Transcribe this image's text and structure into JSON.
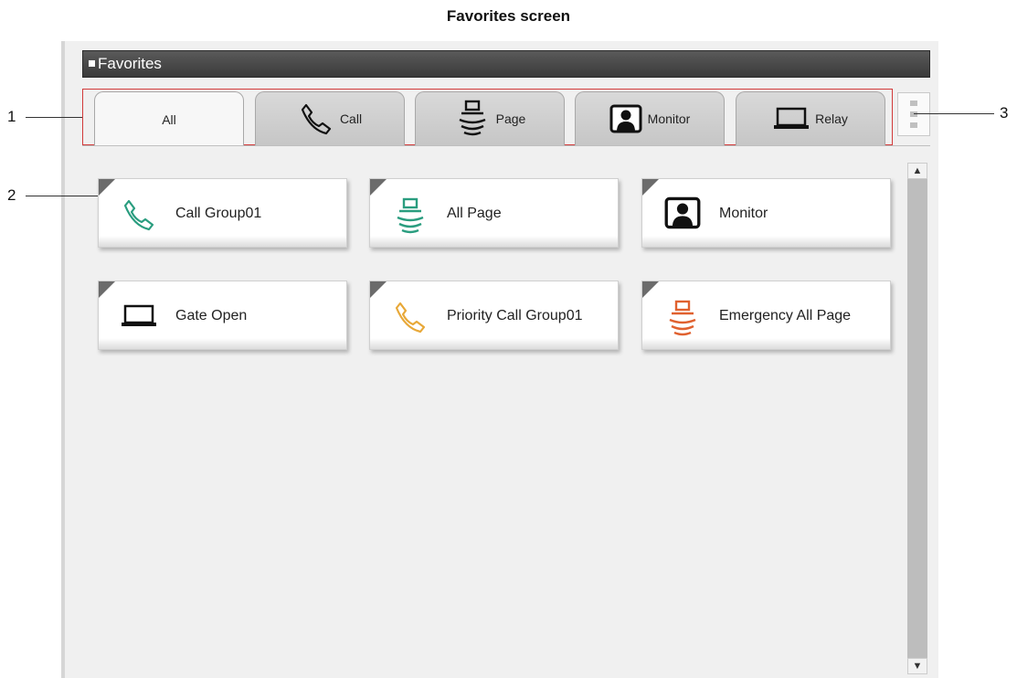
{
  "caption": "Favorites screen",
  "panel_title": "Favorites",
  "tabs": [
    {
      "label": "All",
      "icon": "none",
      "active": true
    },
    {
      "label": "Call",
      "icon": "phone-icon"
    },
    {
      "label": "Page",
      "icon": "speaker-icon"
    },
    {
      "label": "Monitor",
      "icon": "monitor-icon"
    },
    {
      "label": "Relay",
      "icon": "relay-icon"
    }
  ],
  "favorites": [
    {
      "label": "Call Group01",
      "icon": "phone-icon",
      "color": "#2a9d7f"
    },
    {
      "label": "All Page",
      "icon": "speaker-icon",
      "color": "#2a9d7f"
    },
    {
      "label": "Monitor",
      "icon": "monitor-icon",
      "color": "#111111"
    },
    {
      "label": "Gate Open",
      "icon": "relay-icon",
      "color": "#111111"
    },
    {
      "label": "Priority Call Group01",
      "icon": "phone-icon",
      "color": "#e8a838"
    },
    {
      "label": "Emergency All Page",
      "icon": "speaker-icon",
      "color": "#e0612f"
    }
  ],
  "callouts": [
    "1",
    "2",
    "3"
  ],
  "scrollbar": {
    "up": "▲",
    "down": "▼"
  }
}
